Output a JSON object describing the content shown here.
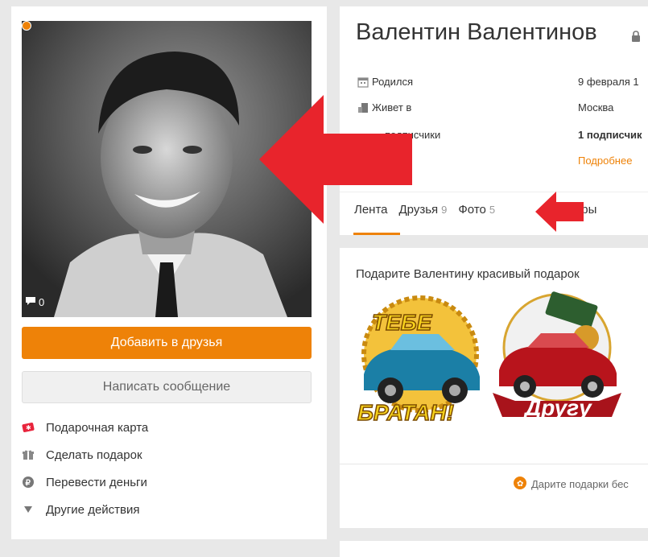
{
  "profile": {
    "name": "Валентин Валентинов",
    "comment_count": "0",
    "info": [
      {
        "label": "Родился",
        "value": "9 февраля 1"
      },
      {
        "label": "Живет в",
        "value": "Москва"
      },
      {
        "label": "подписчики",
        "value": "1 подписчик"
      }
    ],
    "more_link": "Подробнее"
  },
  "buttons": {
    "add_friend": "Добавить в друзья",
    "write_message": "Написать сообщение"
  },
  "actions": [
    {
      "label": "Подарочная карта",
      "icon": "gift-card-icon"
    },
    {
      "label": "Сделать подарок",
      "icon": "present-icon"
    },
    {
      "label": "Перевести деньги",
      "icon": "ruble-icon"
    },
    {
      "label": "Другие действия",
      "icon": "triangle-down-icon"
    }
  ],
  "tabs": [
    {
      "label": "Лента",
      "count": ""
    },
    {
      "label": "Друзья",
      "count": "9"
    },
    {
      "label": "Фото",
      "count": "5"
    },
    {
      "label": "пы",
      "count": ""
    },
    {
      "label": "Игры",
      "count": ""
    }
  ],
  "gifts": {
    "title": "Подарите Валентину красивый подарок",
    "items": [
      {
        "line1": "ТЕБЕ",
        "line2": "БРАТАН!"
      },
      {
        "line1": "",
        "line2": "Другу"
      }
    ],
    "footer": "Дарите подарки бес"
  },
  "colors": {
    "accent": "#ee8208",
    "arrow": "#e8242c",
    "background": "#e8e8e8"
  }
}
